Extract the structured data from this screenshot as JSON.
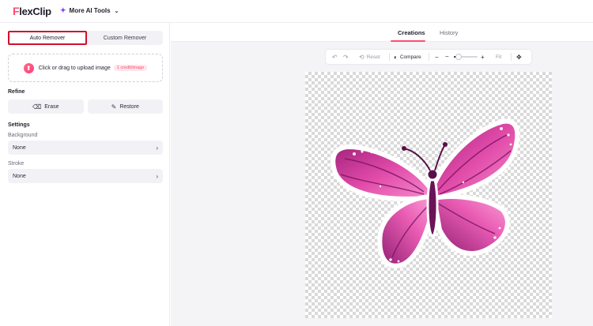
{
  "app": {
    "logo_first": "F",
    "logo_rest": "lexClip",
    "ai_tools_label": "More AI Tools"
  },
  "left": {
    "tabs": [
      {
        "label": "Auto Remover",
        "active": true
      },
      {
        "label": "Custom Remover",
        "active": false
      }
    ],
    "upload": {
      "text": "Click or drag to upload image",
      "credit": "1 credit/image"
    },
    "refine": {
      "title": "Refine",
      "erase_label": "Erase",
      "restore_label": "Restore"
    },
    "settings": {
      "title": "Settings",
      "background_label": "Background",
      "background_value": "None",
      "stroke_label": "Stroke",
      "stroke_value": "None"
    }
  },
  "workspace": {
    "tabs": [
      {
        "label": "Creations",
        "active": true
      },
      {
        "label": "History",
        "active": false
      }
    ],
    "toolbar": {
      "reset_label": "Reset",
      "compare_label": "Compare",
      "fit_label": "Fit",
      "zoom_fraction": 0.2
    },
    "image": {
      "subject": "pink butterfly sticker",
      "background": "transparent"
    }
  },
  "colors": {
    "brand": "#ff4b6e",
    "highlight": "#d0112b",
    "wing_dark": "#8e1f72",
    "wing_light": "#f46fbf"
  }
}
